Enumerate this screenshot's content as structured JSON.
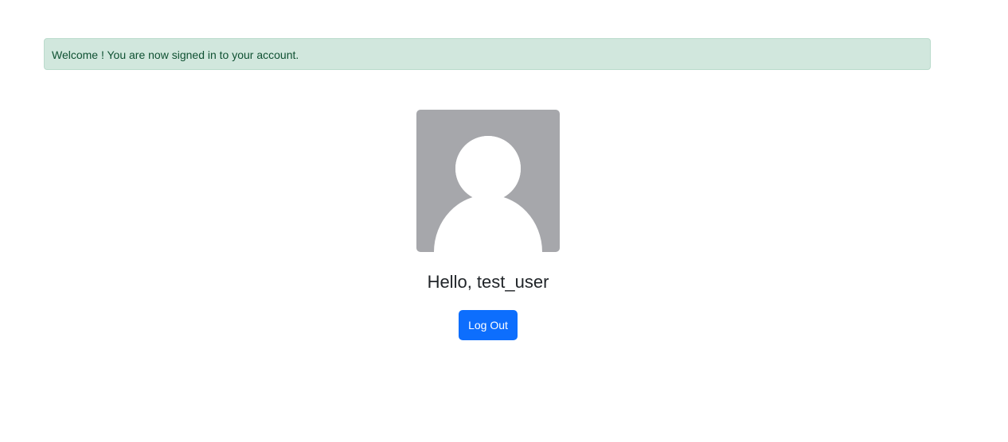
{
  "alert": {
    "message": "Welcome ! You are now signed in to your account.",
    "background": "#d1e7dd",
    "text_color": "#0f5132"
  },
  "profile": {
    "avatar_icon": "default-user-avatar-icon",
    "avatar_background": "#a6a7ab",
    "greeting": "Hello, test_user",
    "logout_label": "Log Out",
    "button_color": "#0d6efd"
  }
}
